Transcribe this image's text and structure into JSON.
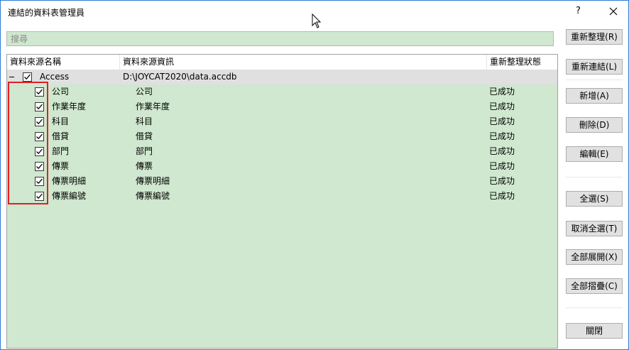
{
  "window": {
    "title": "連結的資料表管理員",
    "help_label": "?",
    "close_label": "✕"
  },
  "search": {
    "placeholder": "搜尋",
    "value": ""
  },
  "table": {
    "columns": [
      "資料來源名稱",
      "資料來源資訊",
      "重新整理狀態"
    ],
    "parent": {
      "name": "Access",
      "info": "D:\\JOYCAT2020\\data.accdb",
      "status": "",
      "checked": true,
      "expanded": true
    },
    "rows": [
      {
        "name": "公司",
        "info": "公司",
        "status": "已成功",
        "checked": true
      },
      {
        "name": "作業年度",
        "info": "作業年度",
        "status": "已成功",
        "checked": true
      },
      {
        "name": "科目",
        "info": "科目",
        "status": "已成功",
        "checked": true
      },
      {
        "name": "借貸",
        "info": "借貸",
        "status": "已成功",
        "checked": true
      },
      {
        "name": "部門",
        "info": "部門",
        "status": "已成功",
        "checked": true
      },
      {
        "name": "傳票",
        "info": "傳票",
        "status": "已成功",
        "checked": true
      },
      {
        "name": "傳票明細",
        "info": "傳票明細",
        "status": "已成功",
        "checked": true
      },
      {
        "name": "傳票編號",
        "info": "傳票編號",
        "status": "已成功",
        "checked": true
      }
    ]
  },
  "buttons": {
    "refresh": "重新整理(R)",
    "relink": "重新連結(L)",
    "add": "新增(A)",
    "delete": "刪除(D)",
    "edit": "編輯(E)",
    "select_all": "全選(S)",
    "deselect_all": "取消全選(T)",
    "expand_all": "全部展開(X)",
    "collapse_all": "全部摺疊(C)",
    "close": "關閉"
  },
  "colors": {
    "list_bg": "#cfe8cf",
    "highlight_box": "#e02020",
    "title_border": "#2b7bd6"
  }
}
